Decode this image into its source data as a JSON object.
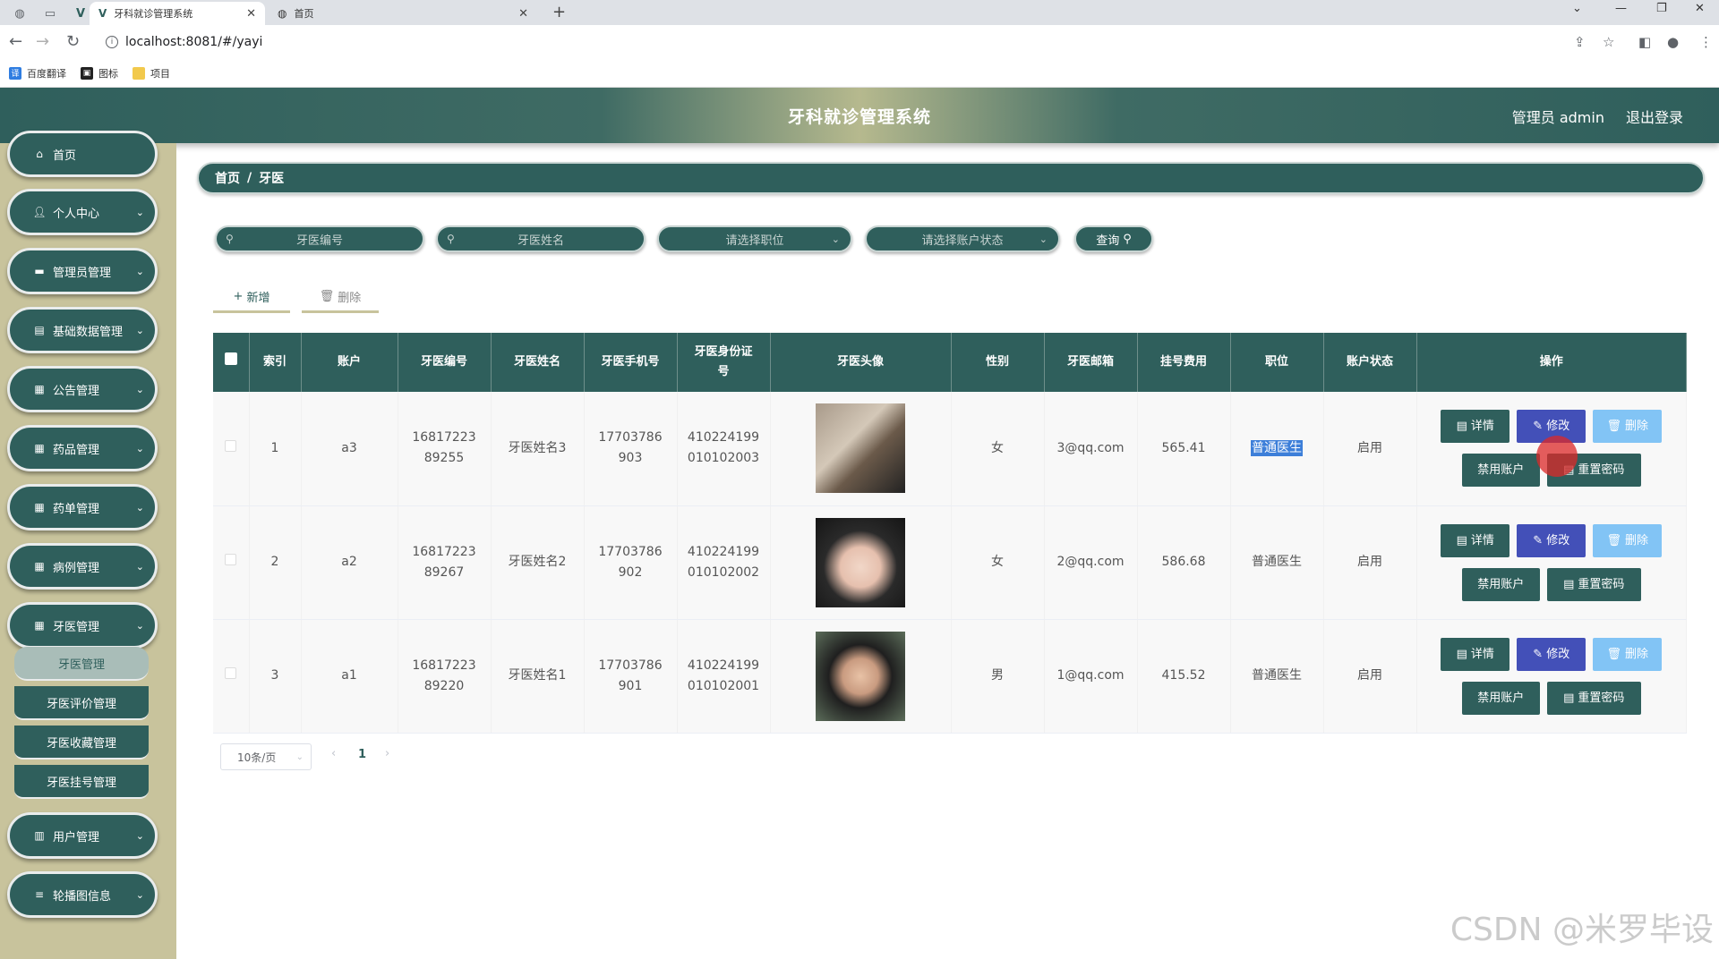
{
  "browser": {
    "tabs": [
      {
        "title": "牙科就诊管理系统",
        "active": true
      },
      {
        "title": "首页",
        "active": false
      }
    ],
    "url": "localhost:8081/#/yayi",
    "bookmarks": [
      "百度翻译",
      "图标",
      "项目"
    ]
  },
  "header": {
    "title": "牙科就诊管理系统",
    "user": "管理员 admin",
    "logout": "退出登录"
  },
  "sidebar": {
    "items": [
      {
        "label": "首页",
        "icon": "home-icon"
      },
      {
        "label": "个人中心",
        "icon": "user-icon"
      },
      {
        "label": "管理员管理",
        "icon": "monitor-icon"
      },
      {
        "label": "基础数据管理",
        "icon": "chart-icon"
      },
      {
        "label": "公告管理",
        "icon": "grid-icon"
      },
      {
        "label": "药品管理",
        "icon": "grid-icon"
      },
      {
        "label": "药单管理",
        "icon": "grid-icon"
      },
      {
        "label": "病例管理",
        "icon": "grid-icon"
      },
      {
        "label": "牙医管理",
        "icon": "grid-icon"
      },
      {
        "label": "用户管理",
        "icon": "clipboard-icon"
      },
      {
        "label": "轮播图信息",
        "icon": "list-icon"
      }
    ],
    "submenu": [
      "牙医管理",
      "牙医评价管理",
      "牙医收藏管理",
      "牙医挂号管理"
    ]
  },
  "breadcrumb": {
    "home": "首页",
    "current": "牙医"
  },
  "filters": {
    "code": "牙医编号",
    "name": "牙医姓名",
    "position": "请选择职位",
    "status": "请选择账户状态",
    "query": "查询"
  },
  "actions": {
    "add": "新增",
    "delete": "删除"
  },
  "table": {
    "headers": [
      "索引",
      "账户",
      "牙医编号",
      "牙医姓名",
      "牙医手机号",
      "牙医身份证号",
      "牙医头像",
      "性别",
      "牙医邮箱",
      "挂号费用",
      "职位",
      "账户状态",
      "操作"
    ],
    "rows": [
      {
        "index": "1",
        "account": "a3",
        "code": "1681722389255",
        "name": "牙医姓名3",
        "phone": "17703786903",
        "idcard": "410224199010102003",
        "gender": "女",
        "email": "3@qq.com",
        "fee": "565.41",
        "position": "普通医生",
        "status": "启用"
      },
      {
        "index": "2",
        "account": "a2",
        "code": "1681722389267",
        "name": "牙医姓名2",
        "phone": "17703786902",
        "idcard": "410224199010102002",
        "gender": "女",
        "email": "2@qq.com",
        "fee": "586.68",
        "position": "普通医生",
        "status": "启用"
      },
      {
        "index": "3",
        "account": "a1",
        "code": "1681722389220",
        "name": "牙医姓名1",
        "phone": "17703786901",
        "idcard": "410224199010102001",
        "gender": "男",
        "email": "1@qq.com",
        "fee": "415.52",
        "position": "普通医生",
        "status": "启用"
      }
    ],
    "ops": {
      "detail": "详情",
      "edit": "修改",
      "delete": "删除",
      "ban": "禁用账户",
      "reset": "重置密码"
    }
  },
  "pager": {
    "size": "10条/页",
    "page": "1"
  },
  "watermark": "CSDN @米罗毕设"
}
